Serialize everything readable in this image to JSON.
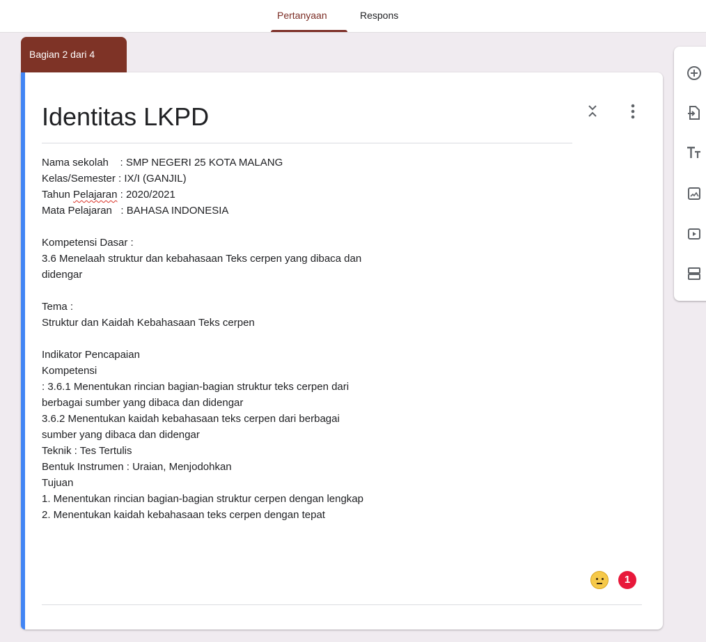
{
  "tabs": [
    {
      "label": "Pertanyaan",
      "active": true
    },
    {
      "label": "Respons",
      "active": false
    }
  ],
  "section": {
    "label": "Bagian 2 dari 4",
    "title": "Identitas LKPD",
    "description": [
      "Nama sekolah    : SMP NEGERI 25 KOTA MALANG",
      "Kelas/Semester : IX/I (GANJIL)",
      "Tahun Pelajaran : 2020/2021",
      "Mata Pelajaran   : BAHASA INDONESIA",
      "",
      "Kompetensi Dasar :",
      "3.6 Menelaah struktur dan kebahasaan Teks cerpen yang dibaca dan",
      "didengar",
      "",
      "Tema :",
      "Struktur dan Kaidah Kebahasaan Teks cerpen",
      "",
      "Indikator Pencapaian",
      "Kompetensi",
      ": 3.6.1 Menentukan rincian bagian-bagian struktur teks cerpen dari",
      "berbagai sumber yang dibaca dan didengar",
      "3.6.2 Menentukan kaidah kebahasaan teks cerpen dari berbagai",
      "sumber yang dibaca dan didengar",
      "Teknik : Tes Tertulis",
      "Bentuk Instrumen : Uraian, Menjodohkan",
      "Tujuan",
      "1. Menentukan rincian bagian-bagian struktur cerpen dengan lengkap",
      "2. Menentukan kaidah kebahasaan teks cerpen dengan tepat"
    ],
    "spellcheck_word": "Pelajaran",
    "issue_count": "1"
  },
  "icons": {
    "collapse": "unfold-less-icon",
    "more": "more-vert-icon",
    "emoji": "neutral-face-icon"
  },
  "toolbar": [
    {
      "icon": "add-circle-icon"
    },
    {
      "icon": "import-questions-icon"
    },
    {
      "icon": "title-text-icon"
    },
    {
      "icon": "image-icon"
    },
    {
      "icon": "video-icon"
    },
    {
      "icon": "section-icon"
    }
  ],
  "colors": {
    "theme": "#7e3326",
    "accent_bar": "#4285f4",
    "background": "#f0ebf0",
    "issue_badge": "#e8183a"
  }
}
